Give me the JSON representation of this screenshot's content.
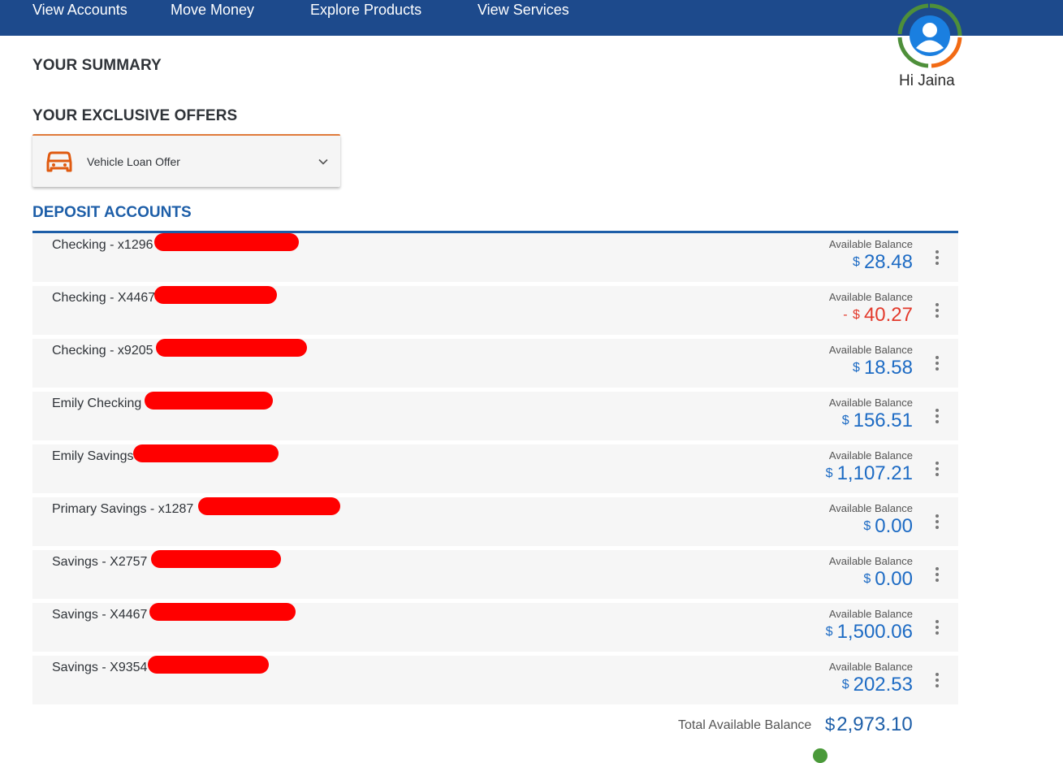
{
  "nav": {
    "items": [
      {
        "label": "View Accounts"
      },
      {
        "label": "Move Money"
      },
      {
        "label": "Explore Products"
      },
      {
        "label": "View Services"
      }
    ]
  },
  "profile": {
    "greeting": "Hi Jaina",
    "avatar_icon": "user-avatar-icon"
  },
  "summary": {
    "title": "YOUR SUMMARY",
    "offers_title": "YOUR EXCLUSIVE OFFERS",
    "offer": {
      "label": "Vehicle Loan Offer",
      "icon": "car-icon"
    }
  },
  "deposit": {
    "title": "DEPOSIT ACCOUNTS",
    "balance_label": "Available Balance",
    "accounts": [
      {
        "name": "Checking - x1296",
        "currency": "$",
        "amount": "28.48",
        "negative": false
      },
      {
        "name": "Checking - X4467",
        "currency": "$",
        "amount": "40.27",
        "negative": true
      },
      {
        "name": "Checking - x9205",
        "currency": "$",
        "amount": "18.58",
        "negative": false
      },
      {
        "name": "Emily Checking",
        "currency": "$",
        "amount": "156.51",
        "negative": false
      },
      {
        "name": "Emily Savings",
        "currency": "$",
        "amount": "1,107.21",
        "negative": false
      },
      {
        "name": "Primary Savings - x1287",
        "currency": "$",
        "amount": "0.00",
        "negative": false
      },
      {
        "name": "Savings - X2757",
        "currency": "$",
        "amount": "0.00",
        "negative": false
      },
      {
        "name": "Savings - X4467",
        "currency": "$",
        "amount": "1,500.06",
        "negative": false
      },
      {
        "name": "Savings - X9354",
        "currency": "$",
        "amount": "202.53",
        "negative": false
      }
    ],
    "negative_prefix": "- ",
    "total_label": "Total Available Balance",
    "total_currency": "$",
    "total_amount": "2,973.10"
  },
  "colors": {
    "nav_bg": "#1d4a8c",
    "accent_blue": "#1d5ea8",
    "amount_blue": "#1d6bc4",
    "negative_red": "#e33a2c",
    "offer_orange": "#e05a10",
    "redaction_red": "#ff0000"
  }
}
